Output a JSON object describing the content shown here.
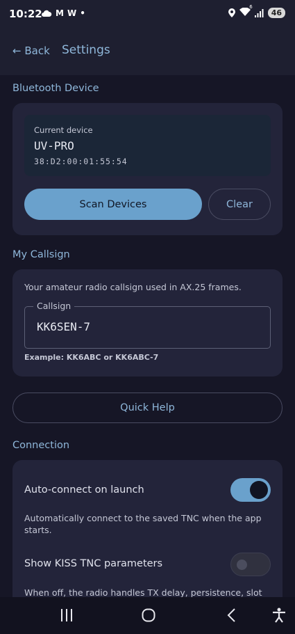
{
  "status_bar": {
    "time": "10:22",
    "left_icons": [
      "cloud-icon",
      "gmail-icon",
      "w-app-icon",
      "dot-icon"
    ],
    "left_text": [
      "M",
      "W",
      "•"
    ],
    "right_icons": [
      "location-icon",
      "wifi-icon",
      "signal-icon"
    ],
    "wifi_badge": "6",
    "battery": "46"
  },
  "header": {
    "back_label": "← Back",
    "title": "Settings"
  },
  "bluetooth": {
    "section_title": "Bluetooth Device",
    "current_label": "Current device",
    "device_name": "UV-PRO",
    "device_mac": "38:D2:00:01:55:54",
    "scan_button": "Scan Devices",
    "clear_button": "Clear"
  },
  "callsign": {
    "section_title": "My Callsign",
    "description": "Your amateur radio callsign used in AX.25 frames.",
    "field_label": "Callsign",
    "field_value": "KK6SEN-7",
    "hint": "Example: KK6ABC or KK6ABC-7"
  },
  "quick_help_button": "Quick Help",
  "connection": {
    "section_title": "Connection",
    "auto_connect": {
      "label": "Auto-connect on launch",
      "description": "Automatically connect to the saved TNC when the app starts.",
      "enabled": true
    },
    "kiss_params": {
      "label": "Show KISS TNC parameters",
      "description": "When off, the radio handles TX delay, persistence, slot",
      "enabled": false
    }
  },
  "colors": {
    "accent": "#6aa1cc",
    "background": "#161626",
    "card": "#23243a",
    "section_title": "#8fb7da"
  },
  "nav_bar": {
    "icons": [
      "recent-apps-icon",
      "home-icon",
      "back-icon",
      "accessibility-icon"
    ]
  }
}
